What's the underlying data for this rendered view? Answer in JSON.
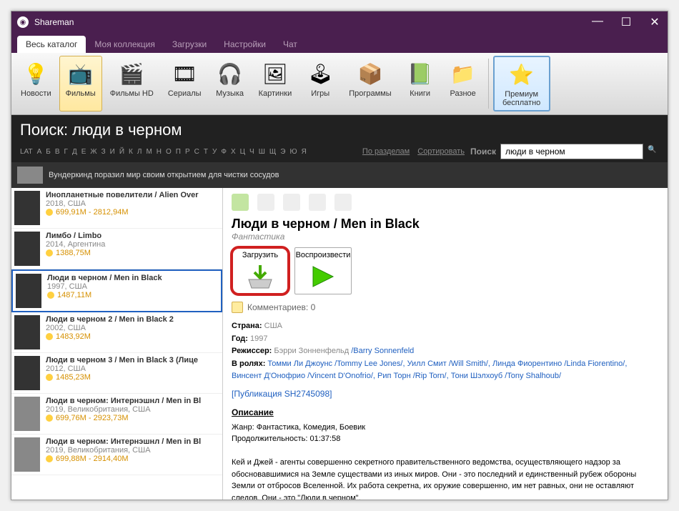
{
  "window": {
    "title": "Shareman"
  },
  "tabs": [
    {
      "label": "Весь каталог",
      "active": true
    },
    {
      "label": "Моя коллекция"
    },
    {
      "label": "Загрузки"
    },
    {
      "label": "Настройки"
    },
    {
      "label": "Чат"
    }
  ],
  "toolbar": [
    {
      "name": "news",
      "label": "Новости",
      "icon": "💡"
    },
    {
      "name": "films",
      "label": "Фильмы",
      "icon": "📺",
      "active": true
    },
    {
      "name": "films-hd",
      "label": "Фильмы HD",
      "icon": "🎬"
    },
    {
      "name": "series",
      "label": "Сериалы",
      "icon": "🎞"
    },
    {
      "name": "music",
      "label": "Музыка",
      "icon": "🎧"
    },
    {
      "name": "pictures",
      "label": "Картинки",
      "icon": "🖼"
    },
    {
      "name": "games",
      "label": "Игры",
      "icon": "🕹"
    },
    {
      "name": "programs",
      "label": "Программы",
      "icon": "📦"
    },
    {
      "name": "books",
      "label": "Книги",
      "icon": "📗"
    },
    {
      "name": "misc",
      "label": "Разное",
      "icon": "📁"
    }
  ],
  "premium": {
    "label": "Премиум бесплатно",
    "icon": "⭐"
  },
  "search": {
    "title": "Поиск: люди в черном",
    "alphabet": [
      "LAT",
      "А",
      "Б",
      "В",
      "Г",
      "Д",
      "Е",
      "Ж",
      "З",
      "И",
      "Й",
      "К",
      "Л",
      "М",
      "Н",
      "О",
      "П",
      "Р",
      "С",
      "Т",
      "У",
      "Ф",
      "Х",
      "Ц",
      "Ч",
      "Ш",
      "Щ",
      "Э",
      "Ю",
      "Я"
    ],
    "by_section": "По разделам",
    "sort": "Сортировать",
    "label": "Поиск",
    "value": "люди в черном"
  },
  "news_banner": "Вундеркинд поразил мир своим открытием для чистки сосудов",
  "list": [
    {
      "title": "Инопланетные повелители / Alien Over",
      "meta": "2018, США",
      "size": "699,91M - 2812,94M"
    },
    {
      "title": "Лимбо / Limbo",
      "meta": "2014, Аргентина",
      "size": "1388,75M"
    },
    {
      "title": "Люди в черном / Men in Black",
      "meta": "1997, США",
      "size": "1487,11M",
      "selected": true
    },
    {
      "title": "Люди в черном 2 / Men in Black 2",
      "meta": "2002, США",
      "size": "1483,92M"
    },
    {
      "title": "Люди в черном 3 / Men in Black 3 (Лице",
      "meta": "2012, США",
      "size": "1485,23M"
    },
    {
      "title": "Люди в черном: Интернэшнл / Men in Bl",
      "meta": "2019, Великобритания, США",
      "size": "699,76M - 2923,73M",
      "tape": true
    },
    {
      "title": "Люди в черном: Интернэшнл / Men in Bl",
      "meta": "2019, Великобритания, США",
      "size": "699,88M - 2914,40M",
      "tape": true
    }
  ],
  "detail": {
    "title": "Люди в черном / Men in Black",
    "genre": "Фантастика",
    "download": "Загрузить",
    "play": "Воспроизвести",
    "comments_label": "Комментариев: 0",
    "country_label": "Страна:",
    "country": "США",
    "year_label": "Год:",
    "year": "1997",
    "director_label": "Режиссер:",
    "director": "Бэрри Зонненфельд",
    "director_en": "/Barry Sonnenfeld",
    "cast_label": "В ролях:",
    "cast": "Томми Ли Джоунс /Tommy Lee Jones/, Уилл Смит /Will Smith/, Линда Фиорентино /Linda Fiorentino/, Винсент Д'Онофрио /Vincent D'Onofrio/, Рип Торн /Rip Torn/, Тони Шэлхоуб /Tony Shalhoub/",
    "pub_id": "[Публикация SH2745098]",
    "desc_header": "Описание",
    "desc_genre": "Жанр: Фантастика, Комедия, Боевик",
    "desc_duration": "Продолжительность: 01:37:58",
    "desc_body": "Кей и Джей - агенты совершенно секретного правительственного ведомства, осуществляющего надзор за обосновавшимися на Земле существами из иных миров. Они - это последний и единственный рубеж обороны Земли от отбросов Вселенной. Их работа секретна, их оружие совершенно, им нет равных, они не оставляют следов. Они - это \"Люди в черном\"."
  }
}
